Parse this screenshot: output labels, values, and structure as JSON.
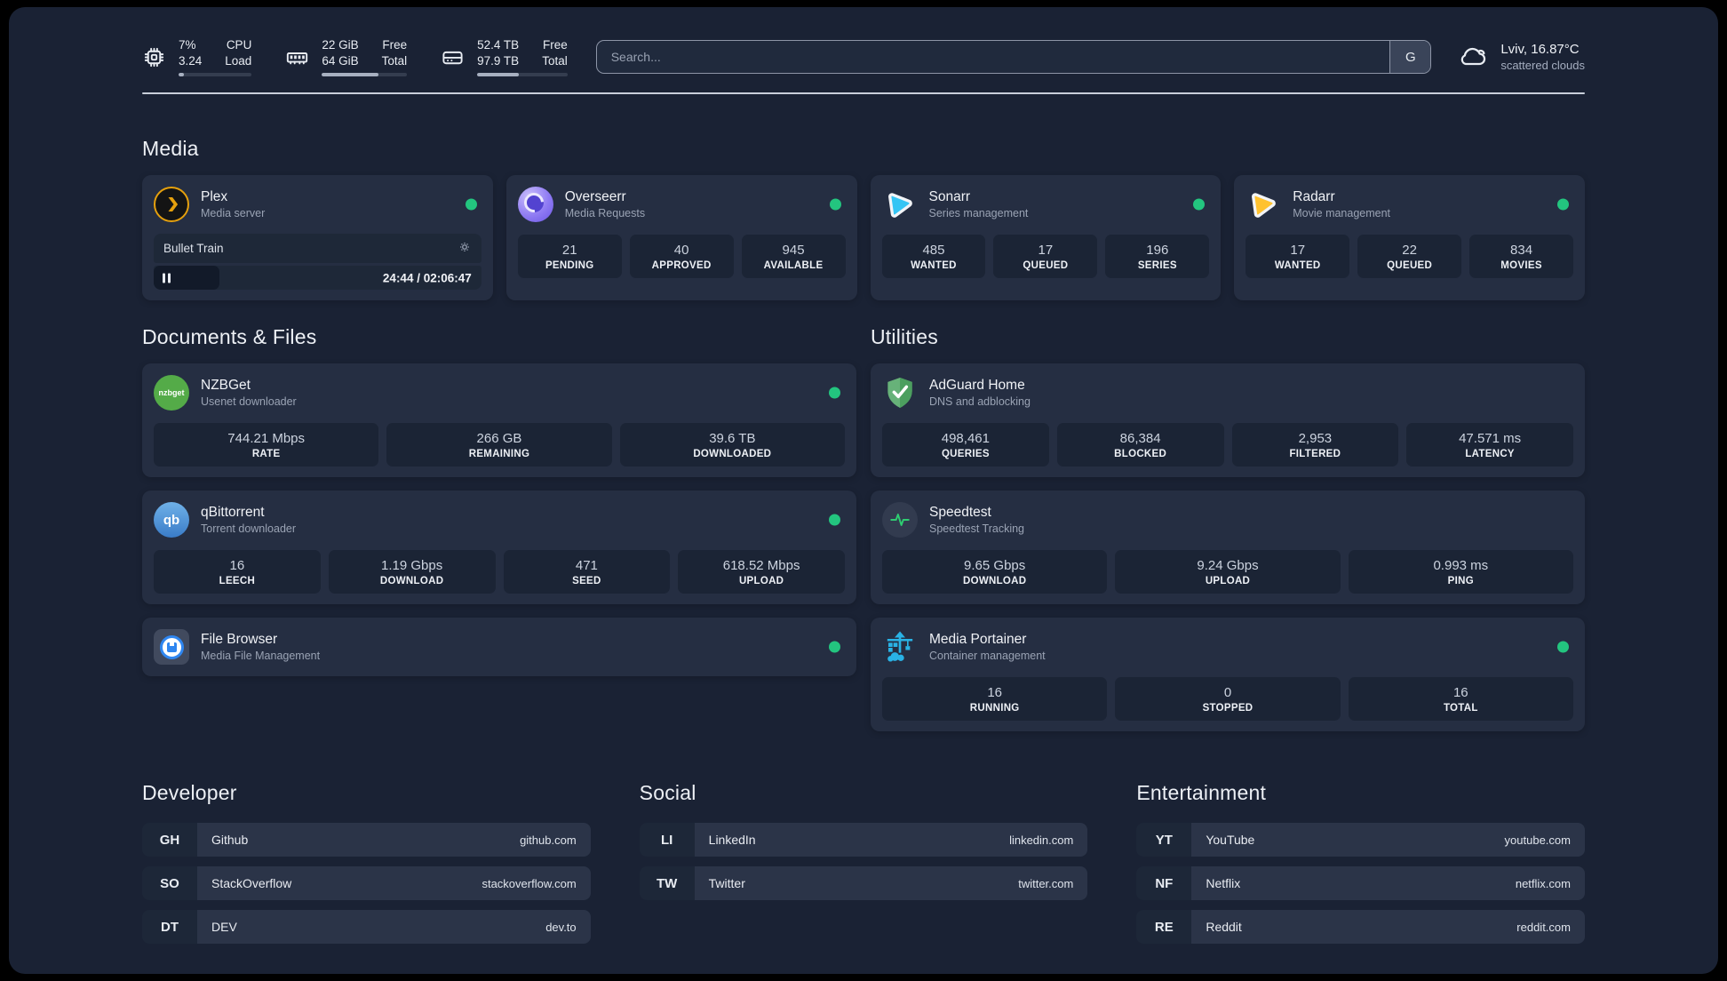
{
  "topbar": {
    "cpu": {
      "value_top": "7%",
      "value_bottom": "3.24",
      "label_top": "CPU",
      "label_bottom": "Load",
      "progress": "7%"
    },
    "memory": {
      "value_top": "22 GiB",
      "value_bottom": "64 GiB",
      "label_top": "Free",
      "label_bottom": "Total",
      "progress": "66%"
    },
    "disk": {
      "value_top": "52.4 TB",
      "value_bottom": "97.9 TB",
      "label_top": "Free",
      "label_bottom": "Total",
      "progress": "46%"
    },
    "search": {
      "placeholder": "Search...",
      "button": "G"
    },
    "weather": {
      "line1": "Lviv, 16.87°C",
      "line2": "scattered clouds"
    }
  },
  "media": {
    "title": "Media",
    "plex": {
      "name": "Plex",
      "subtitle": "Media server",
      "now_playing": "Bullet Train",
      "time": "24:44 / 02:06:47",
      "progress": "20%"
    },
    "overseerr": {
      "name": "Overseerr",
      "subtitle": "Media Requests",
      "stats": [
        {
          "value": "21",
          "label": "PENDING"
        },
        {
          "value": "40",
          "label": "APPROVED"
        },
        {
          "value": "945",
          "label": "AVAILABLE"
        }
      ]
    },
    "sonarr": {
      "name": "Sonarr",
      "subtitle": "Series management",
      "stats": [
        {
          "value": "485",
          "label": "WANTED"
        },
        {
          "value": "17",
          "label": "QUEUED"
        },
        {
          "value": "196",
          "label": "SERIES"
        }
      ]
    },
    "radarr": {
      "name": "Radarr",
      "subtitle": "Movie management",
      "stats": [
        {
          "value": "17",
          "label": "WANTED"
        },
        {
          "value": "22",
          "label": "QUEUED"
        },
        {
          "value": "834",
          "label": "MOVIES"
        }
      ]
    }
  },
  "documents": {
    "title": "Documents & Files",
    "nzbget": {
      "name": "NZBGet",
      "subtitle": "Usenet downloader",
      "icon_text": "nzbget",
      "stats": [
        {
          "value": "744.21 Mbps",
          "label": "RATE"
        },
        {
          "value": "266 GB",
          "label": "REMAINING"
        },
        {
          "value": "39.6 TB",
          "label": "DOWNLOADED"
        }
      ]
    },
    "qbittorrent": {
      "name": "qBittorrent",
      "subtitle": "Torrent downloader",
      "icon_text": "qb",
      "stats": [
        {
          "value": "16",
          "label": "LEECH"
        },
        {
          "value": "1.19 Gbps",
          "label": "DOWNLOAD"
        },
        {
          "value": "471",
          "label": "SEED"
        },
        {
          "value": "618.52 Mbps",
          "label": "UPLOAD"
        }
      ]
    },
    "filebrowser": {
      "name": "File Browser",
      "subtitle": "Media File Management"
    }
  },
  "utilities": {
    "title": "Utilities",
    "adguard": {
      "name": "AdGuard Home",
      "subtitle": "DNS and adblocking",
      "stats": [
        {
          "value": "498,461",
          "label": "QUERIES"
        },
        {
          "value": "86,384",
          "label": "BLOCKED"
        },
        {
          "value": "2,953",
          "label": "FILTERED"
        },
        {
          "value": "47.571 ms",
          "label": "LATENCY"
        }
      ]
    },
    "speedtest": {
      "name": "Speedtest",
      "subtitle": "Speedtest Tracking",
      "stats": [
        {
          "value": "9.65 Gbps",
          "label": "DOWNLOAD"
        },
        {
          "value": "9.24 Gbps",
          "label": "UPLOAD"
        },
        {
          "value": "0.993 ms",
          "label": "PING"
        }
      ]
    },
    "portainer": {
      "name": "Media Portainer",
      "subtitle": "Container management",
      "stats": [
        {
          "value": "16",
          "label": "RUNNING"
        },
        {
          "value": "0",
          "label": "STOPPED"
        },
        {
          "value": "16",
          "label": "TOTAL"
        }
      ]
    }
  },
  "bookmarks": {
    "developer": {
      "title": "Developer",
      "items": [
        {
          "abbr": "GH",
          "name": "Github",
          "url": "github.com"
        },
        {
          "abbr": "SO",
          "name": "StackOverflow",
          "url": "stackoverflow.com"
        },
        {
          "abbr": "DT",
          "name": "DEV",
          "url": "dev.to"
        }
      ]
    },
    "social": {
      "title": "Social",
      "items": [
        {
          "abbr": "LI",
          "name": "LinkedIn",
          "url": "linkedin.com"
        },
        {
          "abbr": "TW",
          "name": "Twitter",
          "url": "twitter.com"
        }
      ]
    },
    "entertainment": {
      "title": "Entertainment",
      "items": [
        {
          "abbr": "YT",
          "name": "YouTube",
          "url": "youtube.com"
        },
        {
          "abbr": "NF",
          "name": "Netflix",
          "url": "netflix.com"
        },
        {
          "abbr": "RE",
          "name": "Reddit",
          "url": "reddit.com"
        }
      ]
    }
  },
  "icons": {
    "cpu": "chip-icon",
    "memory": "ram-icon",
    "disk": "drive-icon",
    "weather": "cloud-icon",
    "plex": "plex-chevron",
    "overseerr": "purple-eye",
    "sonarr": "cyan-play",
    "radarr": "amber-play",
    "nzbget": "green-circle-wordmark",
    "qbittorrent": "blue-circle-qb",
    "filebrowser": "floppy-circle",
    "adguard": "green-shield-check",
    "speedtest": "pulse-line",
    "portainer": "blue-crane",
    "plex_settings": "gear-icon",
    "plex_state": "pause-icon"
  },
  "colors": {
    "status_green": "#23c57f",
    "plex_amber": "#e5a00d",
    "sonarr_cyan": "#35c5f4",
    "radarr_amber": "#ffc230",
    "nzbget_green": "#54ab48",
    "qbittorrent_blue": "#4a90d9",
    "filebrowser_blue": "#2f86f0",
    "adguard_green": "#67b279",
    "speedtest_green": "#2ecc71",
    "portainer_blue": "#29b2e5",
    "background": "#1a2234",
    "card": "#252e42",
    "stat_box": "#1b2435",
    "divider": "#c9cfda"
  }
}
